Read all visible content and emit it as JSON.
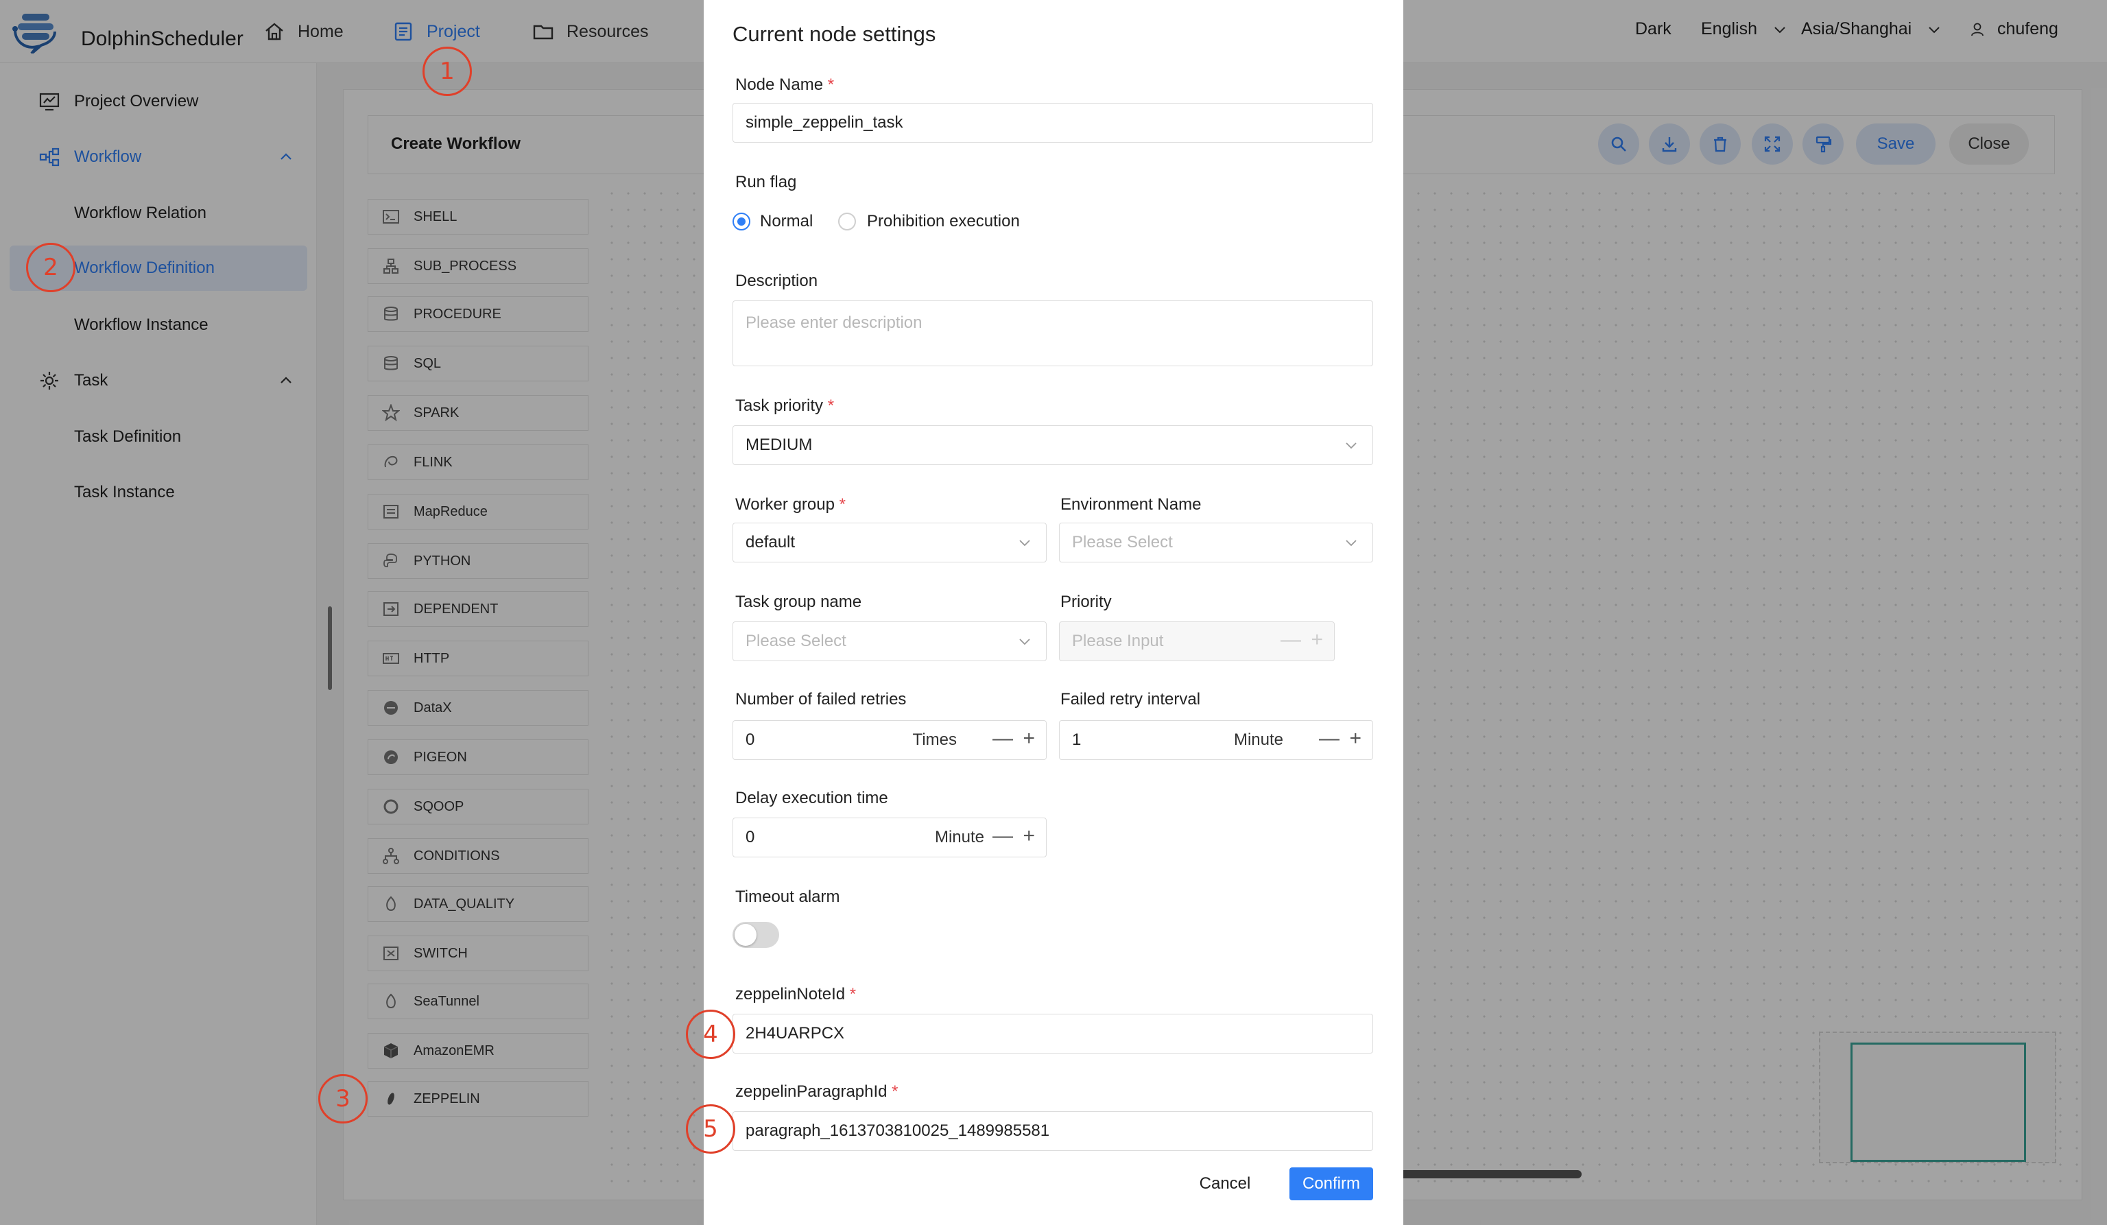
{
  "app": {
    "name": "DolphinScheduler"
  },
  "nav": {
    "home": "Home",
    "project": "Project",
    "resources": "Resources",
    "theme": "Dark",
    "language": "English",
    "timezone": "Asia/Shanghai",
    "user": "chufeng"
  },
  "sidebar": {
    "project_overview": "Project Overview",
    "workflow": "Workflow",
    "workflow_relation": "Workflow Relation",
    "workflow_definition": "Workflow Definition",
    "workflow_instance": "Workflow Instance",
    "task": "Task",
    "task_definition": "Task Definition",
    "task_instance": "Task Instance"
  },
  "workflow_editor": {
    "title": "Create Workflow",
    "save": "Save",
    "close": "Close",
    "tasks": [
      "SHELL",
      "SUB_PROCESS",
      "PROCEDURE",
      "SQL",
      "SPARK",
      "FLINK",
      "MapReduce",
      "PYTHON",
      "DEPENDENT",
      "HTTP",
      "DataX",
      "PIGEON",
      "SQOOP",
      "CONDITIONS",
      "DATA_QUALITY",
      "SWITCH",
      "SeaTunnel",
      "AmazonEMR",
      "ZEPPELIN"
    ]
  },
  "modal": {
    "title": "Current node settings",
    "node_name_label": "Node Name",
    "node_name_value": "simple_zeppelin_task",
    "run_flag_label": "Run flag",
    "run_flag_normal": "Normal",
    "run_flag_prohibit": "Prohibition execution",
    "description_label": "Description",
    "description_placeholder": "Please enter description",
    "task_priority_label": "Task priority",
    "task_priority_value": "MEDIUM",
    "worker_group_label": "Worker group",
    "worker_group_value": "default",
    "environment_label": "Environment Name",
    "environment_placeholder": "Please Select",
    "task_group_label": "Task group name",
    "task_group_placeholder": "Please Select",
    "priority_label": "Priority",
    "priority_placeholder": "Please Input",
    "failed_retries_label": "Number of failed retries",
    "failed_retries_value": "0",
    "failed_retries_unit": "Times",
    "retry_interval_label": "Failed retry interval",
    "retry_interval_value": "1",
    "retry_interval_unit": "Minute",
    "delay_label": "Delay execution time",
    "delay_value": "0",
    "delay_unit": "Minute",
    "timeout_label": "Timeout alarm",
    "note_id_label": "zeppelinNoteId",
    "note_id_value": "2H4UARPCX",
    "paragraph_id_label": "zeppelinParagraphId",
    "paragraph_id_value": "paragraph_1613703810025_1489985581",
    "cancel": "Cancel",
    "confirm": "Confirm",
    "required_mark": "*",
    "minus": "—",
    "plus": "+"
  },
  "annotations": [
    "1",
    "2",
    "3",
    "4",
    "5"
  ]
}
